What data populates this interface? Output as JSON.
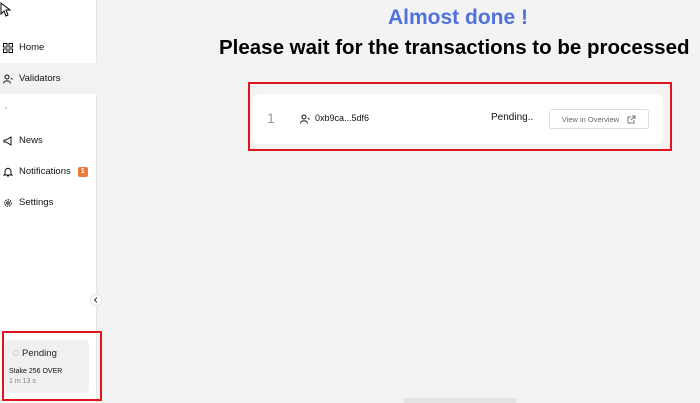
{
  "sidebar": {
    "items": [
      {
        "label": "Home",
        "icon": "grid-icon"
      },
      {
        "label": "Validators",
        "icon": "users-icon"
      },
      {
        "label": "News",
        "icon": "megaphone-icon"
      },
      {
        "label": "Notifications",
        "icon": "bell-icon",
        "badge": "1"
      },
      {
        "label": "Settings",
        "icon": "gear-icon"
      }
    ],
    "pending": {
      "title": "Pending",
      "description": "Stake 256 OVER",
      "time": "1 m 13 s"
    }
  },
  "main": {
    "heading": "Almost done !",
    "subheading": "Please wait for the transactions to be processed",
    "transaction": {
      "index": "1",
      "address": "0xb9ca...5df6",
      "status": "Pending..",
      "view_label": "View in Overview"
    }
  },
  "colors": {
    "accent": "#4f72dc",
    "badge": "#ee7a3a",
    "highlight": "#e0141e"
  }
}
